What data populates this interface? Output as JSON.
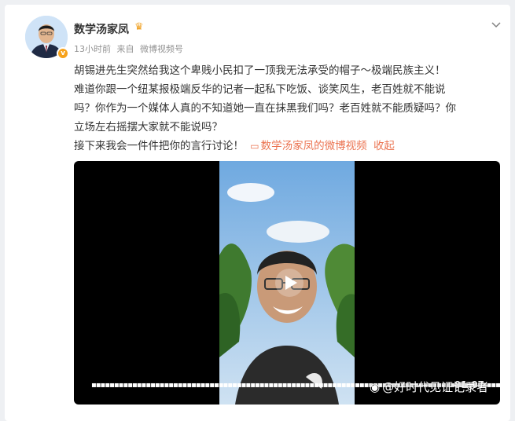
{
  "post": {
    "author": "数学汤家凤",
    "time": "13小时前",
    "source_prefix": "来自",
    "source": "微博视频号",
    "lines": [
      "胡锡进先生突然给我这个卑贱小民扣了一顶我无法承受的帽子～极端民族主义！",
      "难道你跟一个纽某报极端反华的记者一起私下吃饭、谈笑风生，老百姓就不能说",
      "吗？你作为一个媒体人真的不知道她一直在抹黑我们吗？老百姓就不能质疑吗？你",
      "立场左右摇摆大家就不能说吗？"
    ],
    "last_line": "接下来我会一件件把你的言行讨论！",
    "video_link": "数学汤家凤的微博视频",
    "collapse": "收起"
  },
  "video": {
    "duration": "01:07"
  },
  "watermark": "@好时代见证记录者",
  "icons": {
    "menu": "chevron-down-icon",
    "play": "play-icon",
    "video_link": "video-icon",
    "verified": "verified-badge-icon",
    "weibo": "weibo-logo-icon"
  },
  "colors": {
    "link": "#eb7350",
    "verified": "#f7a21b",
    "text": "#333333",
    "meta": "#939393"
  }
}
